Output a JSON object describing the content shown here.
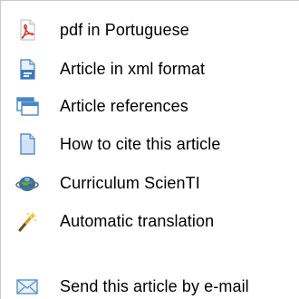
{
  "menu": {
    "items": [
      {
        "label": "pdf in Portuguese",
        "icon": "pdf-icon"
      },
      {
        "label": "Article in xml format",
        "icon": "xml-document-icon"
      },
      {
        "label": "Article references",
        "icon": "references-window-icon"
      },
      {
        "label": "How to cite this article",
        "icon": "cite-document-icon"
      },
      {
        "label": "Curriculum ScienTI",
        "icon": "globe-icon"
      },
      {
        "label": "Automatic translation",
        "icon": "magic-wand-icon"
      },
      {
        "label": "Send this article by e-mail",
        "icon": "email-envelope-icon"
      }
    ]
  },
  "colors": {
    "pdf_red": "#d93a2b",
    "doc_blue": "#3b78c2",
    "window_blue": "#4a86c8",
    "globe_blue": "#2f6fb0",
    "wand_gold": "#e2a21a",
    "envelope_blue": "#5b93c9",
    "border": "#c8c8c8"
  }
}
